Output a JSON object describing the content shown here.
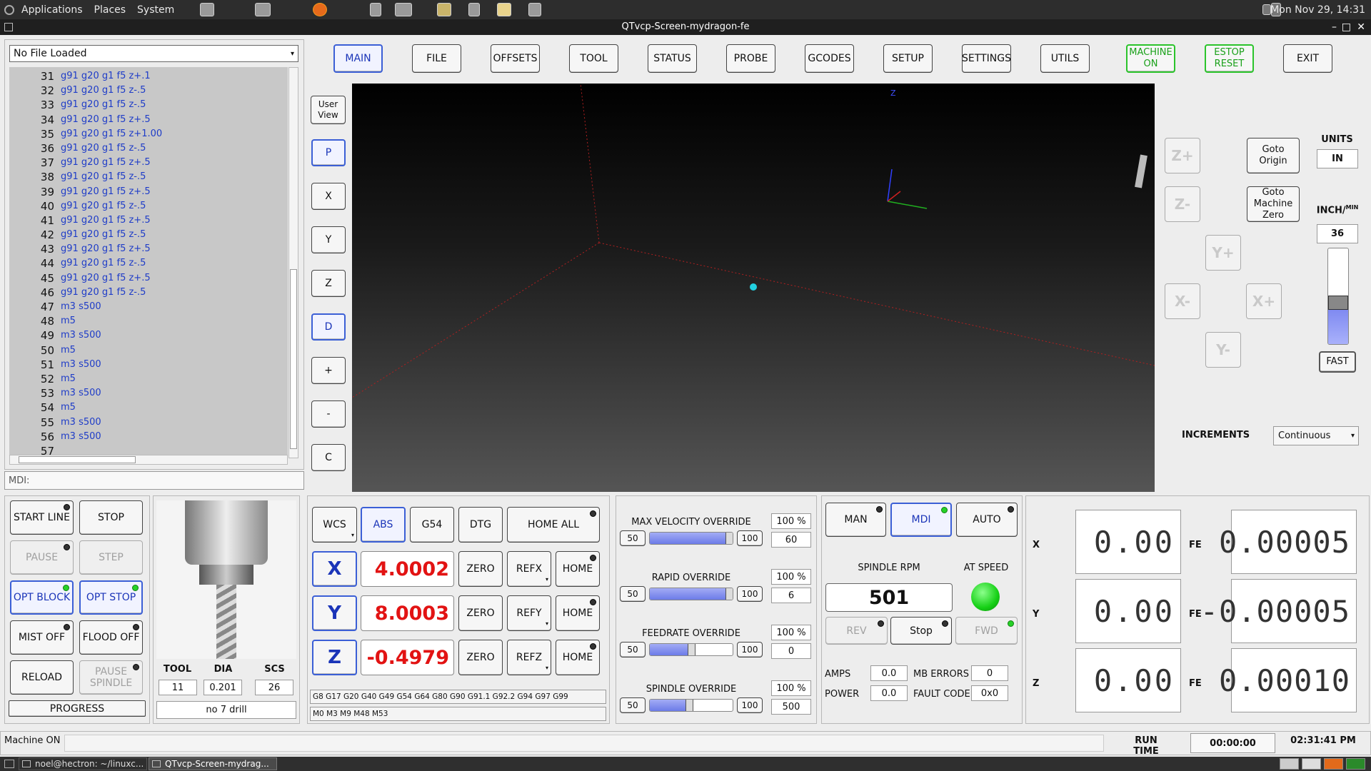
{
  "desktop": {
    "menu": [
      "Applications",
      "Places",
      "System"
    ],
    "clock": "Mon Nov 29, 14:31"
  },
  "window": {
    "title": "QTvcp-Screen-mydragon-fe"
  },
  "file": {
    "selected": "No File Loaded"
  },
  "gcode_lines": [
    {
      "n": "31",
      "code": "g91 g20 g1 f5 z+.1"
    },
    {
      "n": "32",
      "code": "g91 g20 g1 f5 z-.5"
    },
    {
      "n": "33",
      "code": "g91 g20 g1 f5 z-.5"
    },
    {
      "n": "34",
      "code": "g91 g20 g1 f5 z+.5"
    },
    {
      "n": "35",
      "code": "g91 g20 g1 f5 z+1.00"
    },
    {
      "n": "36",
      "code": "g91 g20 g1 f5 z-.5"
    },
    {
      "n": "37",
      "code": "g91 g20 g1 f5 z+.5"
    },
    {
      "n": "38",
      "code": "g91 g20 g1 f5 z-.5"
    },
    {
      "n": "39",
      "code": "g91 g20 g1 f5 z+.5"
    },
    {
      "n": "40",
      "code": "g91 g20 g1 f5 z-.5"
    },
    {
      "n": "41",
      "code": "g91 g20 g1 f5 z+.5"
    },
    {
      "n": "42",
      "code": "g91 g20 g1 f5 z-.5"
    },
    {
      "n": "43",
      "code": "g91 g20 g1 f5 z+.5"
    },
    {
      "n": "44",
      "code": "g91 g20 g1 f5 z-.5"
    },
    {
      "n": "45",
      "code": "g91 g20 g1 f5 z+.5"
    },
    {
      "n": "46",
      "code": "g91 g20 g1 f5 z-.5"
    },
    {
      "n": "47",
      "code": "m3 s500"
    },
    {
      "n": "48",
      "code": "m5"
    },
    {
      "n": "49",
      "code": "m3 s500"
    },
    {
      "n": "50",
      "code": "m5"
    },
    {
      "n": "51",
      "code": "m3 s500"
    },
    {
      "n": "52",
      "code": "m5"
    },
    {
      "n": "53",
      "code": "m3 s500"
    },
    {
      "n": "54",
      "code": "m5"
    },
    {
      "n": "55",
      "code": "m3 s500"
    },
    {
      "n": "56",
      "code": "m3 s500"
    },
    {
      "n": "57",
      "code": ""
    }
  ],
  "mdi": {
    "label": "MDI:"
  },
  "tabs": [
    "MAIN",
    "FILE",
    "OFFSETS",
    "TOOL",
    "STATUS",
    "PROBE",
    "GCODES",
    "SETUP",
    "SETTINGS",
    "UTILS"
  ],
  "top_buttons": {
    "machine_on": "MACHINE ON",
    "estop": "ESTOP RESET",
    "exit": "EXIT"
  },
  "view_buttons": {
    "user_view": "User View",
    "items": [
      "P",
      "X",
      "Y",
      "Z",
      "D",
      "+",
      "-",
      "C"
    ]
  },
  "jog": {
    "z_plus": "Z+",
    "z_minus": "Z-",
    "y_plus": "Y+",
    "y_minus": "Y-",
    "x_minus": "X-",
    "x_plus": "X+",
    "goto_origin": "Goto Origin",
    "goto_zero": "Goto Machine Zero",
    "units_label": "UNITS",
    "units": "IN",
    "rate_label": "INCH/",
    "rate_unit": "MIN",
    "rate": "36",
    "rate_level": 0.38,
    "fast": "FAST",
    "increments_label": "INCREMENTS",
    "increments": "Continuous"
  },
  "controls": {
    "start_line": "START LINE",
    "stop": "STOP",
    "pause": "PAUSE",
    "step": "STEP",
    "opt_block": "OPT BLOCK",
    "opt_stop": "OPT STOP",
    "mist": "MIST OFF",
    "flood": "FLOOD OFF",
    "reload": "RELOAD",
    "pause_spindle": "PAUSE SPINDLE",
    "progress": "PROGRESS"
  },
  "tool": {
    "tool_label": "TOOL",
    "dia_label": "DIA",
    "scs_label": "SCS",
    "tool": "11",
    "dia": "0.201",
    "scs": "26",
    "desc": "no 7 drill"
  },
  "dro": {
    "wcs": "WCS",
    "abs": "ABS",
    "g54": "G54",
    "dtg": "DTG",
    "home_all": "HOME ALL",
    "zero": "ZERO",
    "home": "HOME",
    "axes": [
      {
        "name": "X",
        "value": "4.0002",
        "ref": "REFX"
      },
      {
        "name": "Y",
        "value": "8.0003",
        "ref": "REFY"
      },
      {
        "name": "Z",
        "value": "-0.4979",
        "ref": "REFZ"
      }
    ],
    "gcodes": "G8 G17 G20 G40 G49 G54 G64 G80 G90 G91.1 G92.2 G94 G97 G99",
    "mcodes": "M0 M3 M9 M48 M53"
  },
  "overrides": [
    {
      "label": "MAX VELOCITY OVERRIDE",
      "pct": "100 %",
      "min": "50",
      "max": "100",
      "value": "60",
      "level": 1.0
    },
    {
      "label": "RAPID OVERRIDE",
      "pct": "100 %",
      "min": "50",
      "max": "100",
      "value": "6",
      "level": 1.0
    },
    {
      "label": "FEEDRATE OVERRIDE",
      "pct": "100 %",
      "min": "50",
      "max": "100",
      "value": "0",
      "level": 0.5
    },
    {
      "label": "SPINDLE OVERRIDE",
      "pct": "100 %",
      "min": "50",
      "max": "100",
      "value": "500",
      "level": 0.47
    }
  ],
  "spindle": {
    "man": "MAN",
    "mdi": "MDI",
    "auto": "AUTO",
    "rpm_label": "SPINDLE RPM",
    "rpm": "501",
    "at_speed": "AT SPEED",
    "rev": "REV",
    "stop": "Stop",
    "fwd": "FWD",
    "amps_label": "AMPS",
    "amps": "0.0",
    "power_label": "POWER",
    "power": "0.0",
    "mb_label": "MB ERRORS",
    "mb": "0",
    "fault_label": "FAULT CODE",
    "fault": "0x0"
  },
  "fe": [
    {
      "axis": "X",
      "pos": "0.00",
      "fe_label": "FE",
      "fe": "0.00005"
    },
    {
      "axis": "Y",
      "pos": "0.00",
      "fe_label": "FE",
      "fe": "-0.00005"
    },
    {
      "axis": "Z",
      "pos": "0.00",
      "fe_label": "FE",
      "fe": "0.00010"
    }
  ],
  "status": {
    "text": "Machine ON",
    "run_label": "RUN TIME",
    "run": "00:00:00",
    "clock": "02:31:41 PM"
  },
  "taskbar": {
    "items": [
      "noel@hectron: ~/linuxc...",
      "QTvcp-Screen-mydrag..."
    ]
  },
  "colors": {
    "accent_blue": "#3b5fd6",
    "green": "#2bc42b",
    "dro_red": "#e21313"
  }
}
